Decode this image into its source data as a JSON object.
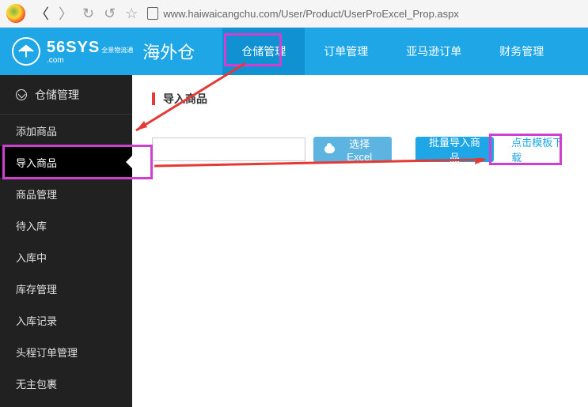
{
  "url": "www.haiwaicangchu.com/User/Product/UserProExcel_Prop.aspx",
  "logo": {
    "main": "56SYS",
    "sub": "全景物流通",
    "domain": ".com",
    "cn": "海外仓"
  },
  "nav": [
    {
      "label": "仓储管理",
      "active": true
    },
    {
      "label": "订单管理"
    },
    {
      "label": "亚马逊订单"
    },
    {
      "label": "财务管理"
    }
  ],
  "sidebar": {
    "header": "仓储管理",
    "items": [
      {
        "label": "添加商品"
      },
      {
        "label": "导入商品",
        "active": true
      },
      {
        "label": "商品管理"
      },
      {
        "label": "待入库"
      },
      {
        "label": "入库中"
      },
      {
        "label": "库存管理"
      },
      {
        "label": "入库记录"
      },
      {
        "label": "头程订单管理"
      },
      {
        "label": "无主包裹"
      }
    ]
  },
  "content": {
    "crumb": "导入商品",
    "select_btn": "选择Excel",
    "import_btn": "批量导入商品",
    "download_link": "点击模板下载"
  }
}
